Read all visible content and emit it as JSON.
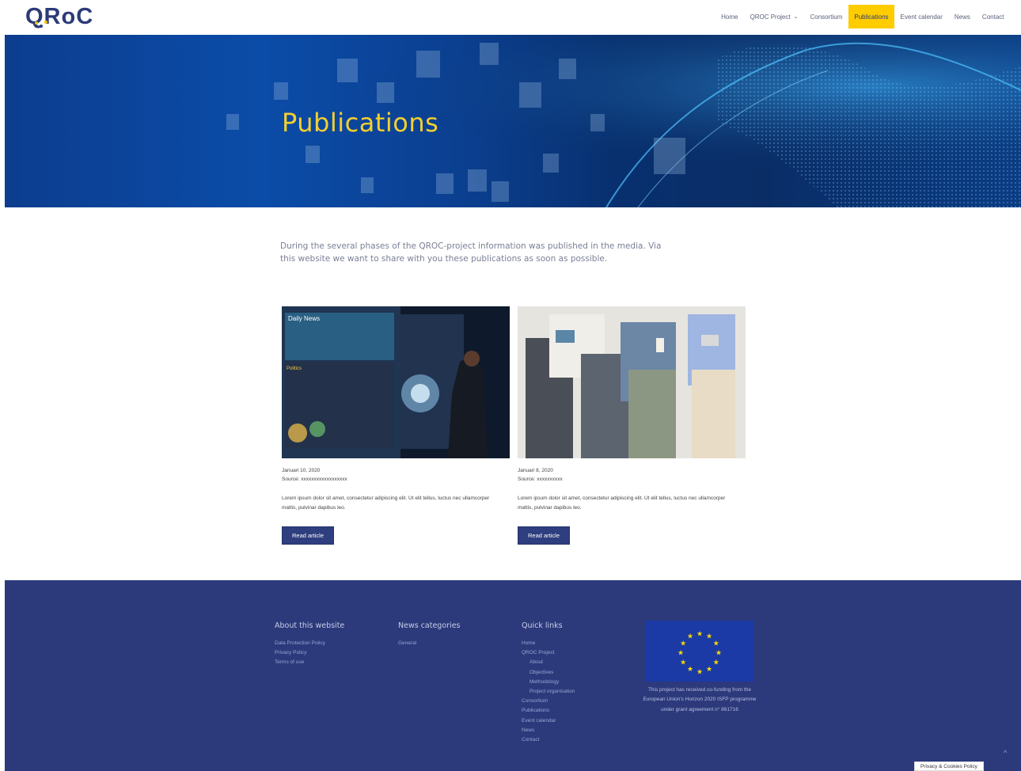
{
  "header": {
    "logo_text": "QRoC",
    "nav": [
      {
        "label": "Home"
      },
      {
        "label": "QROC Project",
        "has_dropdown": true
      },
      {
        "label": "Consortium"
      },
      {
        "label": "Publications",
        "active": true
      },
      {
        "label": "Event calendar"
      },
      {
        "label": "News"
      },
      {
        "label": "Contact"
      }
    ]
  },
  "hero": {
    "title": "Publications"
  },
  "intro": {
    "text": "During the several phases of the QROC-project information was published in the media. Via this website we want to share with you these publications as soon as possible."
  },
  "cards": [
    {
      "image": "woman-touching-digital-news-wall",
      "date": "Januari 10, 2020",
      "source": "Source: xxxxxxxxxxxxxxxxxx",
      "text": "Lorem ipsum dolor sit amet, consectetur adipiscing elit. Ut elit tellus, luctus nec ullamcorper mattis, pulvinar dapibus leo.",
      "button": "Read article"
    },
    {
      "image": "people-reading-newspaper-and-phones",
      "date": "Januari 8, 2020",
      "source": "Source: xxxxxxxxxx",
      "text": "Lorem ipsum dolor sit amet, consectetur adipiscing elit. Ut elit tellus, luctus nec ullamcorper mattis, pulvinar dapibus leo.",
      "button": "Read article"
    }
  ],
  "footer": {
    "about": {
      "heading": "About this website",
      "links": [
        "Data Protection Policy",
        "Privacy Policy",
        "Terms of use"
      ]
    },
    "news": {
      "heading": "News categories",
      "links": [
        "General"
      ]
    },
    "quick": {
      "heading": "Quick links",
      "links": [
        {
          "label": "Home",
          "sub": false
        },
        {
          "label": "QROC Project",
          "sub": false
        },
        {
          "label": "About",
          "sub": true
        },
        {
          "label": "Objectives",
          "sub": true
        },
        {
          "label": "Methodology",
          "sub": true
        },
        {
          "label": "Project organisation",
          "sub": true
        },
        {
          "label": "Consortium",
          "sub": false
        },
        {
          "label": "Publications",
          "sub": false
        },
        {
          "label": "Event calendar",
          "sub": false
        },
        {
          "label": "News",
          "sub": false
        },
        {
          "label": "Contact",
          "sub": false
        }
      ]
    },
    "eu": {
      "flag": "eu-flag",
      "text": "This project has received co-funding from the European Union's Horizon 2020 ISFP programme under grant agreement n° 861716"
    },
    "scroll_top": "^"
  },
  "cookie_button": "Privacy & Cookies Policy",
  "colors": {
    "brand_navy": "#2c3a7c",
    "accent_yellow": "#ffcc00",
    "hero_title": "#f4cf2e"
  }
}
